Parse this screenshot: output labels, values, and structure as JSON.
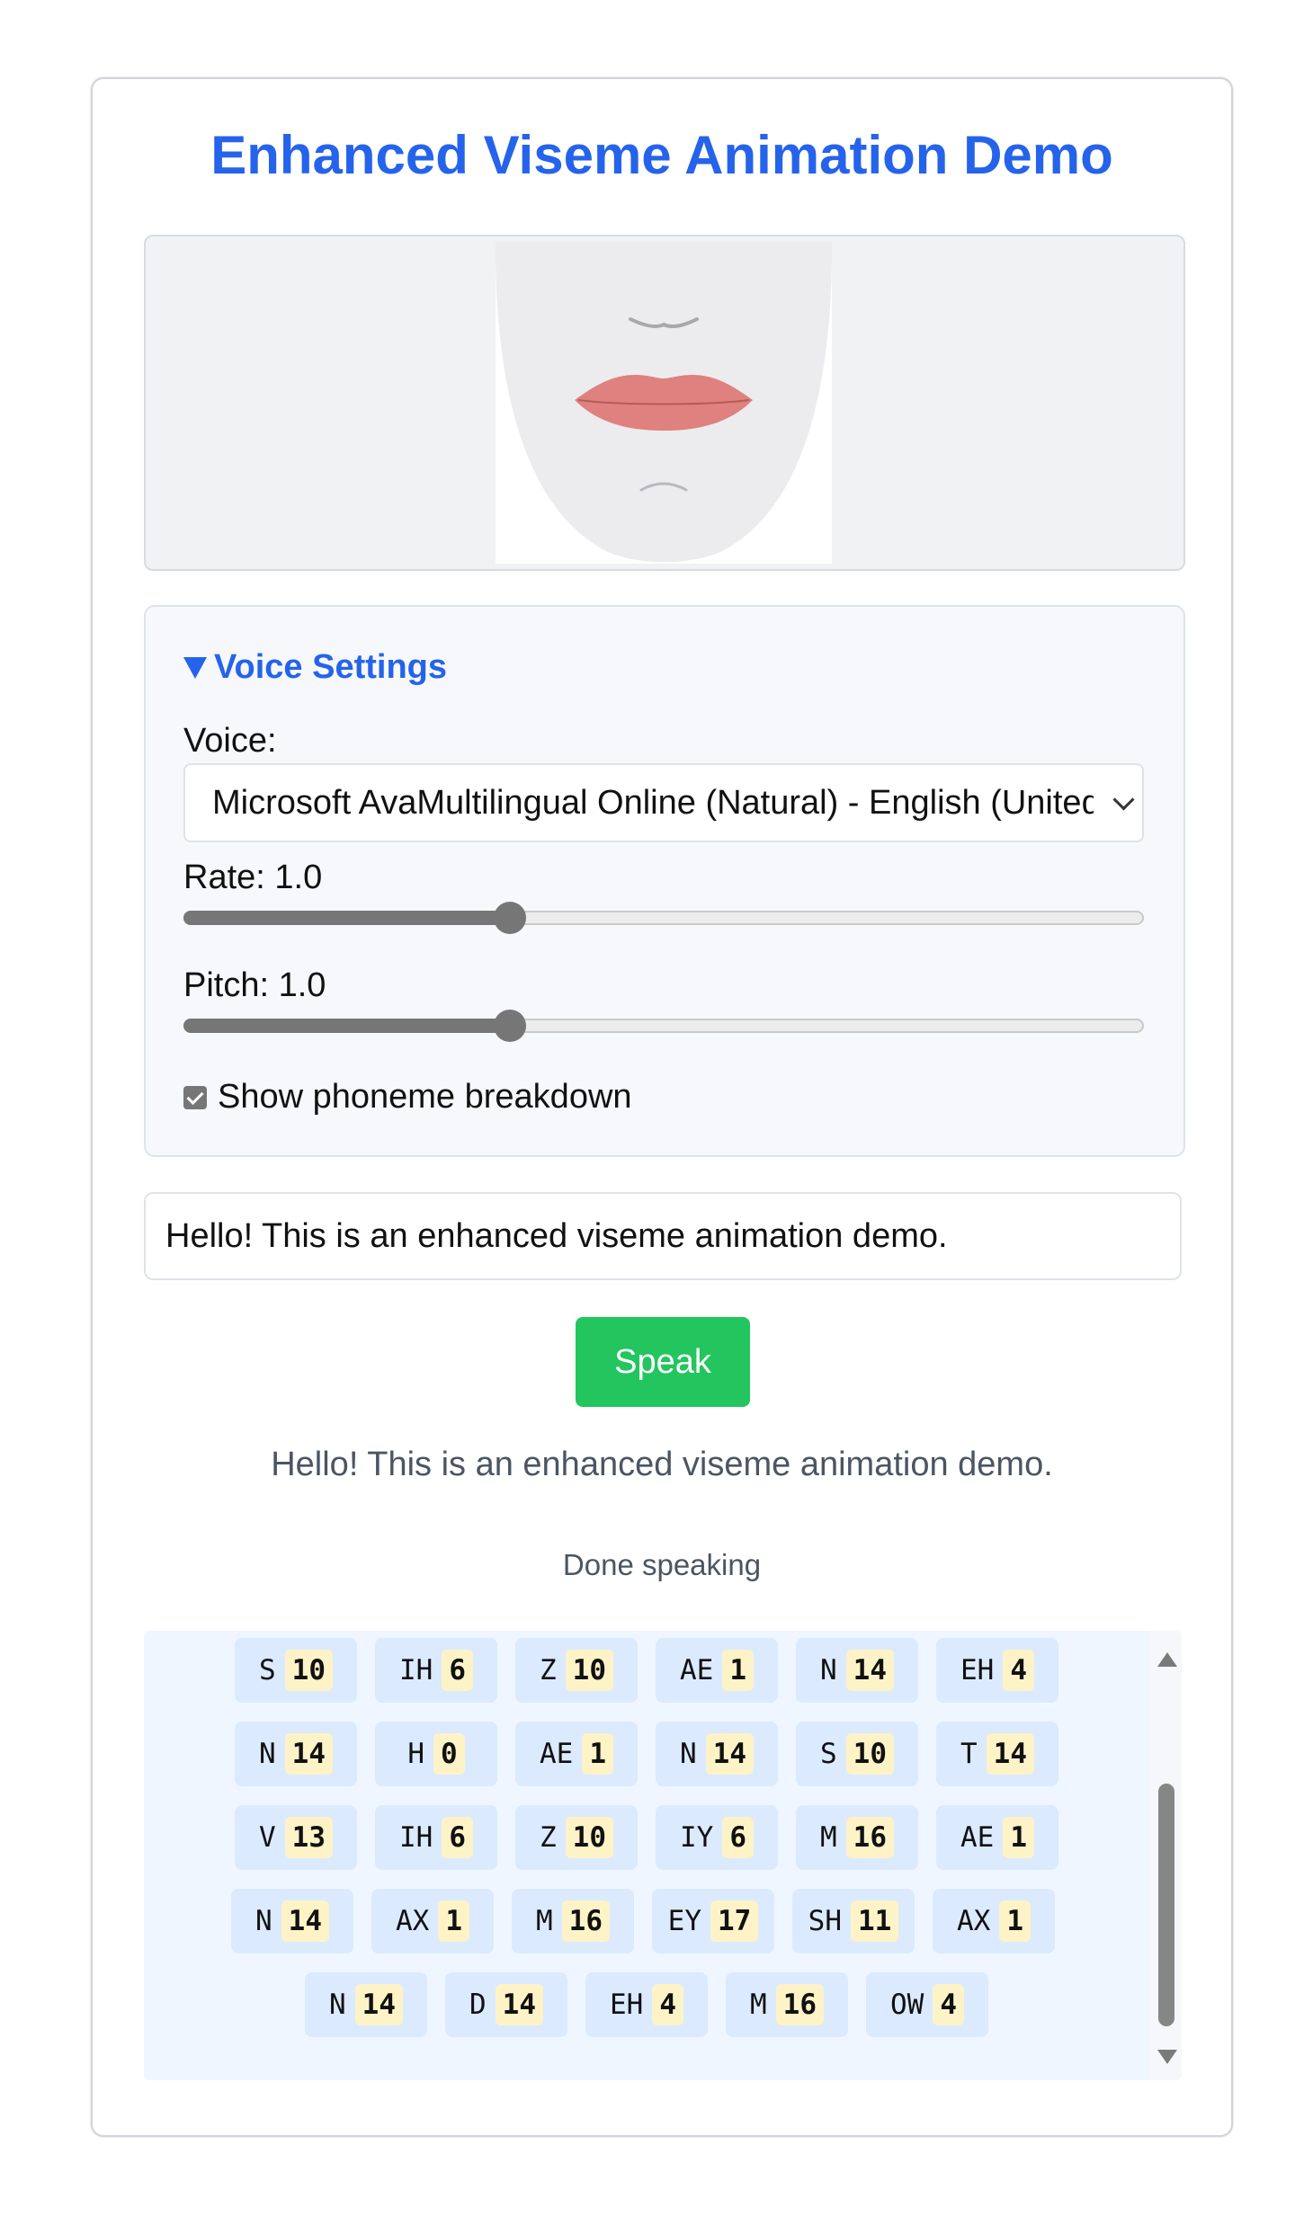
{
  "app": {
    "title": "Enhanced Viseme Animation Demo"
  },
  "colors": {
    "accent": "#2563eb",
    "speak_button": "#22c55e",
    "chip_bg": "#dbeafe",
    "chip_num_bg": "#fef3c7"
  },
  "settings": {
    "summary": "Voice Settings",
    "voice_label": "Voice:",
    "voice_value": "Microsoft AvaMultilingual Online (Natural) - English (United States)",
    "rate_label": "Rate: 1.0",
    "rate_value": 1.0,
    "rate_fraction": 0.34,
    "pitch_label": "Pitch: 1.0",
    "pitch_value": 1.0,
    "pitch_fraction": 0.34,
    "show_breakdown_label": "Show phoneme breakdown",
    "show_breakdown_checked": true
  },
  "input": {
    "text": "Hello! This is an enhanced viseme animation demo."
  },
  "speak_button": {
    "label": "Speak"
  },
  "spoken_text": "Hello! This is an enhanced viseme animation demo.",
  "status": "Done speaking",
  "phoneme_rows": [
    [
      {
        "ph": "S",
        "v": "10"
      },
      {
        "ph": "IH",
        "v": "6"
      },
      {
        "ph": "Z",
        "v": "10"
      },
      {
        "ph": "AE",
        "v": "1"
      },
      {
        "ph": "N",
        "v": "14"
      },
      {
        "ph": "EH",
        "v": "4"
      }
    ],
    [
      {
        "ph": "N",
        "v": "14"
      },
      {
        "ph": "H",
        "v": "0"
      },
      {
        "ph": "AE",
        "v": "1"
      },
      {
        "ph": "N",
        "v": "14"
      },
      {
        "ph": "S",
        "v": "10"
      },
      {
        "ph": "T",
        "v": "14"
      }
    ],
    [
      {
        "ph": "V",
        "v": "13"
      },
      {
        "ph": "IH",
        "v": "6"
      },
      {
        "ph": "Z",
        "v": "10"
      },
      {
        "ph": "IY",
        "v": "6"
      },
      {
        "ph": "M",
        "v": "16"
      },
      {
        "ph": "AE",
        "v": "1"
      }
    ],
    [
      {
        "ph": "N",
        "v": "14"
      },
      {
        "ph": "AX",
        "v": "1"
      },
      {
        "ph": "M",
        "v": "16"
      },
      {
        "ph": "EY",
        "v": "17"
      },
      {
        "ph": "SH",
        "v": "11"
      },
      {
        "ph": "AX",
        "v": "1"
      }
    ],
    [
      {
        "ph": "N",
        "v": "14"
      },
      {
        "ph": "D",
        "v": "14"
      },
      {
        "ph": "EH",
        "v": "4"
      },
      {
        "ph": "M",
        "v": "16"
      },
      {
        "ph": "OW",
        "v": "4"
      }
    ]
  ]
}
